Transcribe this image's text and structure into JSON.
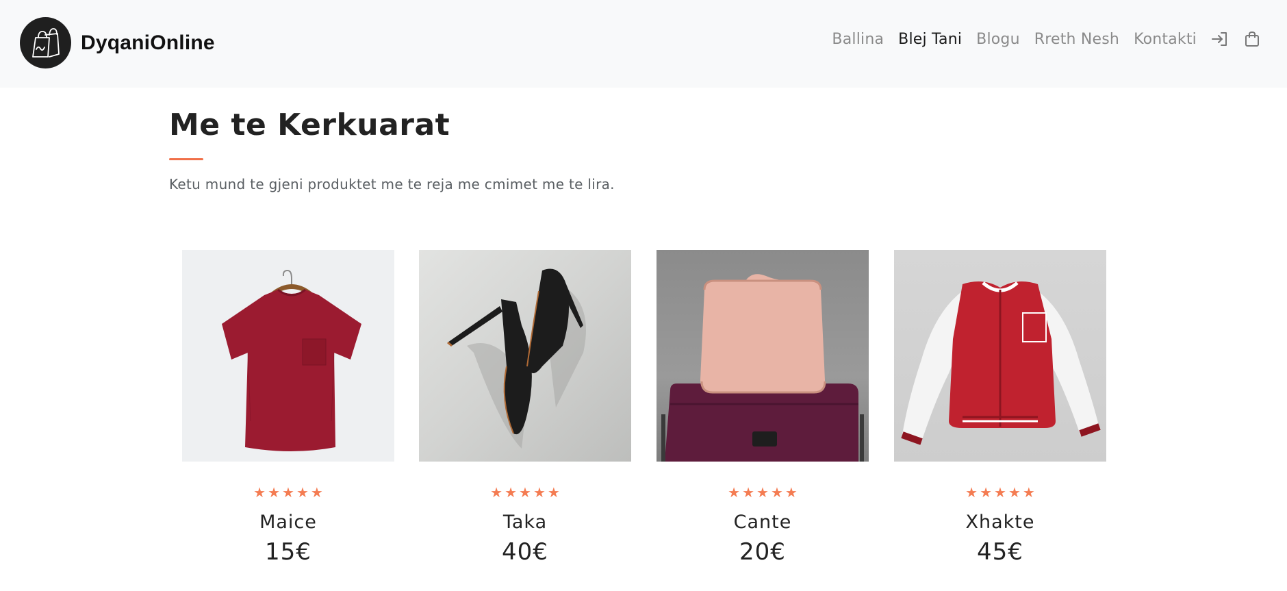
{
  "brand": {
    "name": "DyqaniOnline",
    "logo_icon": "shopping-bag-icon"
  },
  "nav": {
    "links": [
      {
        "label": "Ballina",
        "active": false
      },
      {
        "label": "Blej Tani",
        "active": true
      },
      {
        "label": "Blogu",
        "active": false
      },
      {
        "label": "Rreth Nesh",
        "active": false
      },
      {
        "label": "Kontakti",
        "active": false
      }
    ],
    "login_icon": "login-icon",
    "cart_icon": "shopping-bag-icon"
  },
  "section": {
    "title": "Me te Kerkuarat",
    "subtitle": "Ketu mund te gjeni produktet me te reja me cmimet me te lira."
  },
  "products": [
    {
      "name": "Maice",
      "price": "15€",
      "rating": 5,
      "image": "red t-shirt on hanger"
    },
    {
      "name": "Taka",
      "price": "40€",
      "rating": 5,
      "image": "black high heels"
    },
    {
      "name": "Cante",
      "price": "20€",
      "rating": 5,
      "image": "pink toiletry bag on suitcase"
    },
    {
      "name": "Xhakte",
      "price": "45€",
      "rating": 5,
      "image": "red varsity jacket"
    }
  ],
  "colors": {
    "accent": "#f07048",
    "star": "#f47c52",
    "navbar_bg": "#f8f9fa"
  }
}
